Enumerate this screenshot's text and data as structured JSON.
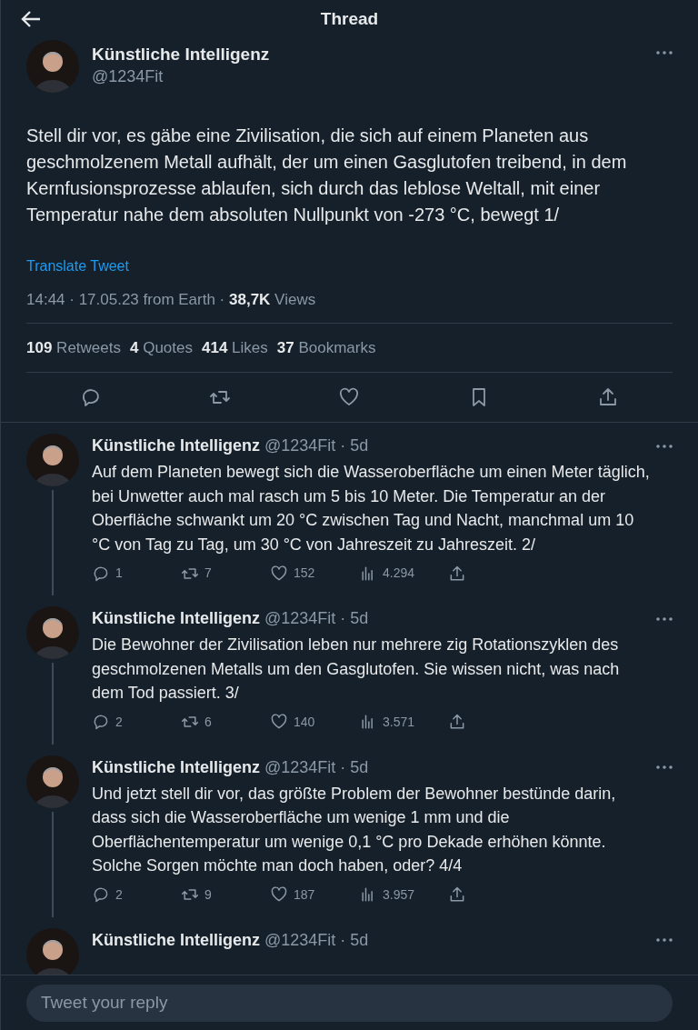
{
  "header": {
    "title": "Thread"
  },
  "tweet": {
    "name": "Künstliche Intelligenz",
    "handle": "@1234Fit",
    "text": "Stell dir vor, es gäbe eine Zivilisation, die sich auf einem Planeten aus geschmolzenem Metall aufhält, der um einen Gasglutofen treibend, in dem Kernfusionsprozesse ablaufen, sich durch das leblose Weltall, mit einer Temperatur nahe dem absoluten Nullpunkt von -273 °C, bewegt 1/",
    "translate": "Translate Tweet",
    "meta": "14:44 · 17.05.23 from Earth · **38,7K** Views",
    "stats": [
      "**109** Retweets",
      "**4** Quotes",
      "**414** Likes",
      "**37** Bookmarks"
    ],
    "actions": [
      {
        "kind": "reply"
      },
      {
        "kind": "retweet"
      },
      {
        "kind": "like"
      },
      {
        "kind": "bookmark"
      },
      {
        "kind": "share"
      }
    ]
  },
  "replies": [
    {
      "name": "Künstliche Intelligenz",
      "meta": "@1234Fit · 5d",
      "text": "Auf dem Planeten bewegt sich die Wasseroberfläche um einen Meter täglich, bei Unwetter auch mal rasch um 5 bis 10 Meter. Die Temperatur an der Oberfläche schwankt um 20 °C zwischen Tag und Nacht, manchmal um 10 °C von Tag zu Tag, um 30 °C von Jahreszeit zu Jahreszeit. 2/",
      "actions": [
        {
          "kind": "reply",
          "count": "1"
        },
        {
          "kind": "retweet",
          "count": "7"
        },
        {
          "kind": "like",
          "count": "152"
        },
        {
          "kind": "views",
          "count": "4.294"
        },
        {
          "kind": "share"
        }
      ]
    },
    {
      "name": "Künstliche Intelligenz",
      "meta": "@1234Fit · 5d",
      "text": "Die Bewohner der Zivilisation leben nur mehrere zig Rotationszyklen des geschmolzenen Metalls um den Gasglutofen. Sie wissen nicht, was nach dem Tod passiert. 3/",
      "actions": [
        {
          "kind": "reply",
          "count": "2"
        },
        {
          "kind": "retweet",
          "count": "6"
        },
        {
          "kind": "like",
          "count": "140"
        },
        {
          "kind": "views",
          "count": "3.571"
        },
        {
          "kind": "share"
        }
      ]
    },
    {
      "name": "Künstliche Intelligenz",
      "meta": "@1234Fit · 5d",
      "text": "Und jetzt stell dir vor, das größte Problem der Bewohner bestünde darin, dass sich die Wasseroberfläche um wenige 1 mm und die Oberflächentemperatur um wenige 0,1 °C pro Dekade erhöhen könnte. Solche Sorgen möchte man doch haben, oder? 4/4",
      "actions": [
        {
          "kind": "reply",
          "count": "2"
        },
        {
          "kind": "retweet",
          "count": "9"
        },
        {
          "kind": "like",
          "count": "187"
        },
        {
          "kind": "views",
          "count": "3.957"
        },
        {
          "kind": "share"
        }
      ]
    },
    {
      "name": "Künstliche Intelligenz",
      "meta": "@1234Fit · 5d"
    }
  ],
  "composer": {
    "placeholder": "Tweet your reply"
  }
}
